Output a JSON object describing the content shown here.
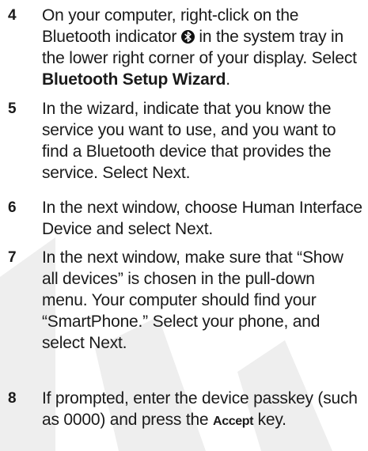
{
  "watermark_color": "#eeeeee",
  "steps": [
    {
      "number": "4",
      "text_before": "On your computer, right-click on the Bluetooth indicator ",
      "icon": "bluetooth-icon",
      "text_after": " in the system tray in the lower right corner of your display. Select ",
      "bold": "Bluetooth Setup Wizard",
      "text_end": "."
    },
    {
      "number": "5",
      "text": "In the wizard, indicate that you know the service you want to use, and you want to find a Bluetooth device that provides the service. Select Next."
    },
    {
      "number": "6",
      "text": "In the next window, choose Human Interface Device and select Next."
    },
    {
      "number": "7",
      "text": "In the next window, make sure that “Show all devices” is chosen in the pull-down menu. Your computer should find your “SmartPhone.” Select your phone, and select Next."
    },
    {
      "number": "8",
      "text_before": "If prompted, enter the device passkey (such as 0000) and press the ",
      "key": "Accept",
      "text_after": " key."
    }
  ]
}
